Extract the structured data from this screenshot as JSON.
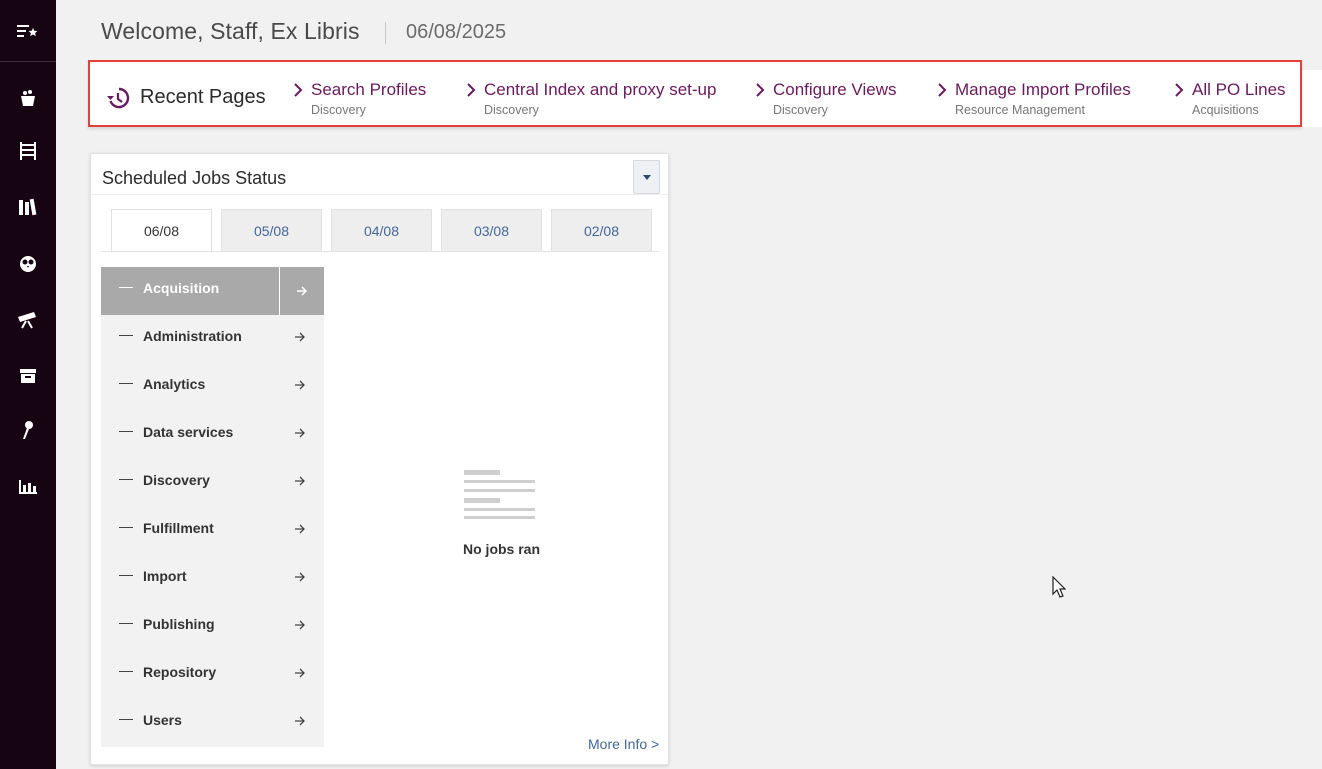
{
  "header": {
    "welcome": "Welcome, Staff, Ex Libris",
    "date": "06/08/2025"
  },
  "recent": {
    "title": "Recent Pages",
    "items": [
      {
        "name": "Search Profiles",
        "area": "Discovery"
      },
      {
        "name": "Central Index and proxy set-up",
        "area": "Discovery"
      },
      {
        "name": "Configure Views",
        "area": "Discovery"
      },
      {
        "name": "Manage Import Profiles",
        "area": "Resource Management"
      },
      {
        "name": "All PO Lines",
        "area": "Acquisitions"
      }
    ]
  },
  "jobs": {
    "title": "Scheduled Jobs Status",
    "tabs": [
      "06/08",
      "05/08",
      "04/08",
      "03/08",
      "02/08"
    ],
    "active_tab": "06/08",
    "categories": [
      "Acquisition",
      "Administration",
      "Analytics",
      "Data services",
      "Discovery",
      "Fulfillment",
      "Import",
      "Publishing",
      "Repository",
      "Users"
    ],
    "active_category": "Acquisition",
    "empty_message": "No jobs ran",
    "more_info": "More Info >"
  },
  "nav_icons": [
    "menu-favorites-icon",
    "acquisitions-icon",
    "resources-icon",
    "library-icon",
    "owl-icon",
    "telescope-icon",
    "archive-icon",
    "pen-icon",
    "analytics-icon"
  ],
  "colors": {
    "rail": "#170412",
    "link_purple": "#6a1a5d",
    "link_blue": "#44679b",
    "highlight_border": "#e0413b"
  }
}
